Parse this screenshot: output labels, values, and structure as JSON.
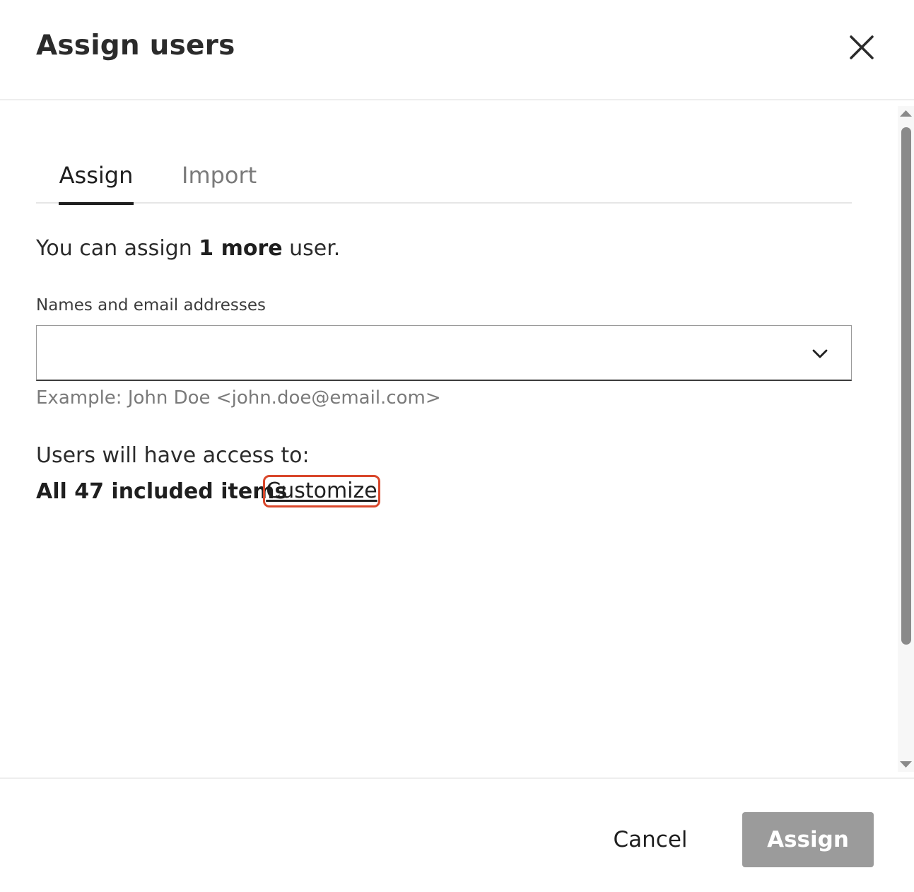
{
  "dialog": {
    "title": "Assign users",
    "close_icon": "close-icon"
  },
  "tabs": [
    {
      "label": "Assign",
      "active": true
    },
    {
      "label": "Import",
      "active": false
    }
  ],
  "quota": {
    "prefix": "You can assign ",
    "count": "1 more",
    "suffix": " user."
  },
  "recipients": {
    "label": "Names and email addresses",
    "value": "",
    "helper": "Example: John Doe <john.doe@email.com>",
    "dropdown_icon": "chevron-down-icon"
  },
  "access": {
    "label": "Users will have access to:",
    "items_text": "All 47 included items",
    "customize_label": "Customize"
  },
  "footer": {
    "cancel_label": "Cancel",
    "assign_label": "Assign",
    "assign_enabled": false
  },
  "colors": {
    "highlight_border": "#d9472b",
    "disabled_button": "#9b9b9b",
    "text_primary": "#1f1f1f",
    "text_muted": "#7a7a7a"
  }
}
